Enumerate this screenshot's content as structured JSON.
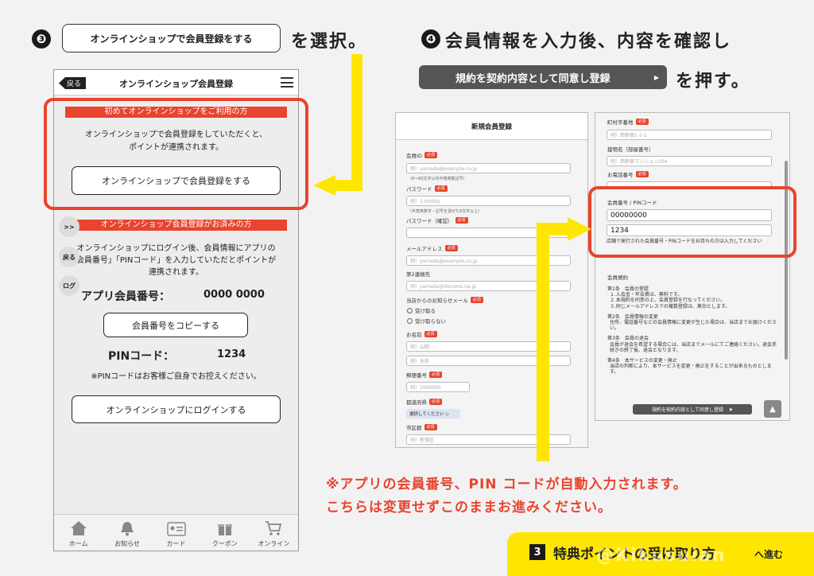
{
  "step3": {
    "num": "❸",
    "button": "オンラインショップで会員登録をする",
    "suffix": "を選択。"
  },
  "step4": {
    "num": "❹",
    "heading": "会員情報を入力後、内容を確認し",
    "button": "規約を契約内容として同意し登録",
    "suffix": "を押す。"
  },
  "phone": {
    "back": "戻る",
    "title": "オンラインショップ会員登録",
    "section1": {
      "header": "初めてオンラインショップをご利用の方",
      "text1": "オンラインショップで会員登録をしていただくと、",
      "text2": "ポイントが連携されます。",
      "button": "オンラインショップで会員登録をする"
    },
    "section2": {
      "header": "オンラインショップ会員登録がお済みの方",
      "text1": "オンラインショップにログイン後、会員情報にアプリの",
      "text2": "会員番号」「PINコード」を入力していただとポイントが",
      "text3": "連携されます。",
      "member_label": "アプリ会員番号：",
      "member_value": "0000 0000",
      "copy_button": "会員番号をコピーする",
      "pin_label": "PINコード：",
      "pin_value": "1234",
      "pin_note": "※PINコードはお客様ご自身でお控えください。",
      "login_button": "オンラインショップにログインする"
    },
    "side": {
      "s1": ">>",
      "s2": "戻る",
      "s3": "ログ"
    },
    "tabs": [
      {
        "label": "ホーム",
        "icon": "home-icon"
      },
      {
        "label": "お知らせ",
        "icon": "bell-icon"
      },
      {
        "label": "カード",
        "icon": "card-icon"
      },
      {
        "label": "クーポン",
        "icon": "gift-icon"
      },
      {
        "label": "オンライン",
        "icon": "cart-icon"
      }
    ]
  },
  "form1": {
    "title": "新規会員登録",
    "required": "必須",
    "fields": {
      "id_label": "会員ID",
      "id_ph": "例）yamada@example.co.jp",
      "id_note": "（6～80文字以内半角英数記号）",
      "pw_label": "パスワード",
      "pw_ph": "例）1-kmbljs",
      "pw_note": "（半角英数字・記号を混ぜた8文字以上）",
      "pw2_label": "パスワード（確認）",
      "mail_label": "メールアドレス",
      "mail_ph": "例）yamada@example.co.jp",
      "mail2_label": "第2連絡先",
      "mail2_ph": "例）yamada@docomo.ne.jp",
      "news_label": "当店からのお知らせメール",
      "news_yes": "受け取る",
      "news_no": "受け取らない",
      "name_label": "お名前",
      "name_ph1": "例）山田",
      "name_ph2": "例）太郎",
      "zip_label": "郵便番号",
      "zip_ph": "例）1000000",
      "pref_label": "都道府県",
      "pref_select": "選択してください ◇",
      "city_label": "市区郡",
      "city_ph": "例）新宿区"
    }
  },
  "form2": {
    "required": "必須",
    "town_label": "町村字番地",
    "town_ph": "例）西新宿1-1-1",
    "bldg_label": "建物名（部屋番号）",
    "bldg_ph": "例）西新宿マンション204",
    "tel_label": "お電話番号",
    "member_label": "会員番号 / PINコード",
    "member_value": "00000000",
    "pin_value": "1234",
    "member_note": "店舗で発行された会員番号・PINコードをお持ちの方は入力してください",
    "terms_title": "会員規約",
    "terms": [
      "第1条　会員の登録",
      "１.入会金・年会費は、無料です。",
      "２.本規約を同意の上、会員登録を行なってください。",
      "３.同じメールアドレスでの複数登録は、無効とします。",
      "第2条　会員情報の変更",
      "住所、電話番号などの会員情報に変更が生じた場合は、当店までお届けください。",
      "第3条　会員の退会",
      "会員が退会を希望する場合には、当店までメールにてご連絡ください。退会手続きの終了後、退会となります。",
      "第4条　本サービスの変更・廃止",
      "当店の判断により、本サービスを変更・廃止をすることが出来るものとします。"
    ],
    "submit": "規約を契約内容として同意し登録"
  },
  "note": {
    "line1": "※アプリの会員番号、PIN コードが自動入力されます。",
    "line2": "こちらは変更せずこのままお進みください。"
  },
  "next": {
    "num": "3",
    "text": "特典ポイントの受け取り方",
    "suffix": "へ進む"
  },
  "watermark": "@Kikusuian",
  "colors": {
    "accent_red": "#e8442e",
    "yellow": "#ffe600",
    "dark": "#1a1a1a"
  }
}
